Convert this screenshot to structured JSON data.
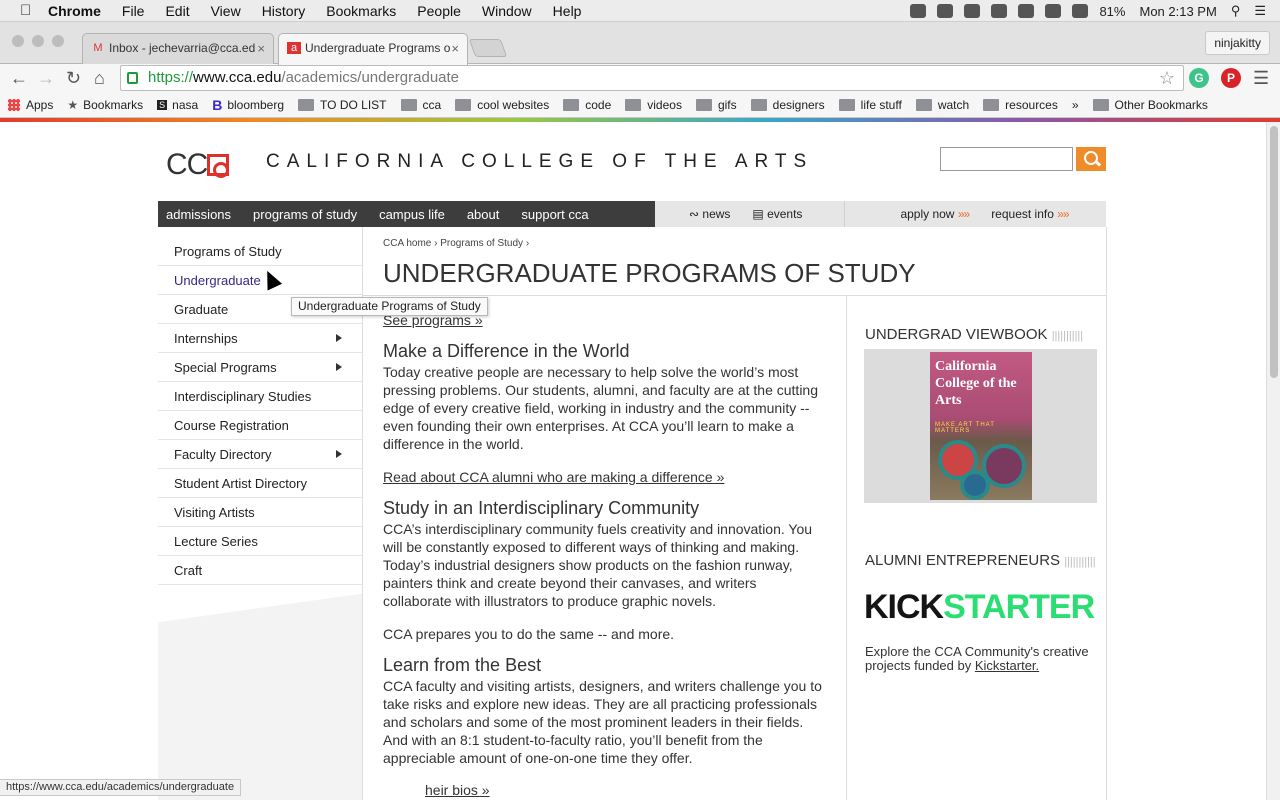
{
  "os_menu": {
    "app": "Chrome",
    "items": [
      "File",
      "Edit",
      "View",
      "History",
      "Bookmarks",
      "People",
      "Window",
      "Help"
    ],
    "battery": "81%",
    "clock": "Mon 2:13 PM"
  },
  "tabs": [
    {
      "title": "Inbox - jechevarria@cca.ed",
      "close": "×"
    },
    {
      "title": "Undergraduate Programs o",
      "close": "×"
    }
  ],
  "profile": "ninjakitty",
  "address": {
    "scheme": "https://",
    "host": "www.cca.edu",
    "path": "/academics/undergraduate"
  },
  "bookmarks": [
    "Apps",
    "Bookmarks",
    "nasa",
    "bloomberg",
    "TO DO LIST",
    "cca",
    "cool websites",
    "code",
    "videos",
    "gifs",
    "designers",
    "life stuff",
    "watch",
    "resources"
  ],
  "bookmarks_more": "»",
  "bookmarks_other": "Other Bookmarks",
  "site": {
    "logo_text": "CC",
    "title": "CALIFORNIA COLLEGE OF THE ARTS",
    "mainnav": [
      "admissions",
      "programs of study",
      "campus life",
      "about",
      "support cca"
    ],
    "secnav": {
      "news": "news",
      "events": "events",
      "apply": "apply now",
      "apply_arrows": "»»",
      "request": "request info",
      "request_arrows": "»»"
    }
  },
  "sidebar": [
    {
      "label": "Programs of Study"
    },
    {
      "label": "Undergraduate"
    },
    {
      "label": "Graduate"
    },
    {
      "label": "Internships"
    },
    {
      "label": "Special Programs"
    },
    {
      "label": "Interdisciplinary Studies"
    },
    {
      "label": "Course Registration"
    },
    {
      "label": "Faculty Directory"
    },
    {
      "label": "Student Artist Directory"
    },
    {
      "label": "Visiting Artists"
    },
    {
      "label": "Lecture Series"
    },
    {
      "label": "Craft"
    }
  ],
  "breadcrumb": "CCA home › Programs of Study ›",
  "page_title": "UNDERGRADUATE PROGRAMS OF STUDY",
  "tooltip": "Undergraduate Programs of Study",
  "see_programs": "See programs »",
  "sections": [
    {
      "heading": "Make a Difference in the World",
      "body": "Today creative people are necessary to help solve the world’s most pressing problems. Our students, alumni, and faculty are at the cutting edge of every creative field, working in industry and the community -- even founding their own enterprises. At CCA you’ll learn to make a difference in the world."
    },
    {
      "link": "Read about CCA alumni who are making a difference »"
    },
    {
      "heading": "Study in an Interdisciplinary Community",
      "body": "CCA’s interdisciplinary community fuels creativity and innovation. You will be constantly exposed to different ways of thinking and making. Today’s industrial designers show products on the fashion runway, painters think and create beyond their canvases, and writers collaborate with illustrators to produce graphic novels."
    },
    {
      "body": "CCA prepares you to do the same -- and more."
    },
    {
      "heading": "Learn from the Best",
      "body": "CCA faculty and visiting artists, designers, and writers challenge you to take risks and explore new ideas. They are all practicing professionals and scholars and some of the most prominent leaders in their fields. And with an 8:1 student-to-faculty ratio, you’ll benefit from the appreciable amount of one-on-one time they offer."
    },
    {
      "link": "heir bios »"
    }
  ],
  "right": {
    "viewbook_heading": "UNDERGRAD VIEWBOOK",
    "book_title": "California College of the Arts",
    "book_tag": "MAKE ART THAT MATTERS",
    "alumni_heading": "ALUMNI ENTREPRENEURS",
    "kick1": "KICK",
    "kick2": "STARTER",
    "kick_text": "Explore the CCA Community's creative projects funded by ",
    "kick_link": "Kickstarter."
  },
  "statusbar": "https://www.cca.edu/academics/undergraduate"
}
